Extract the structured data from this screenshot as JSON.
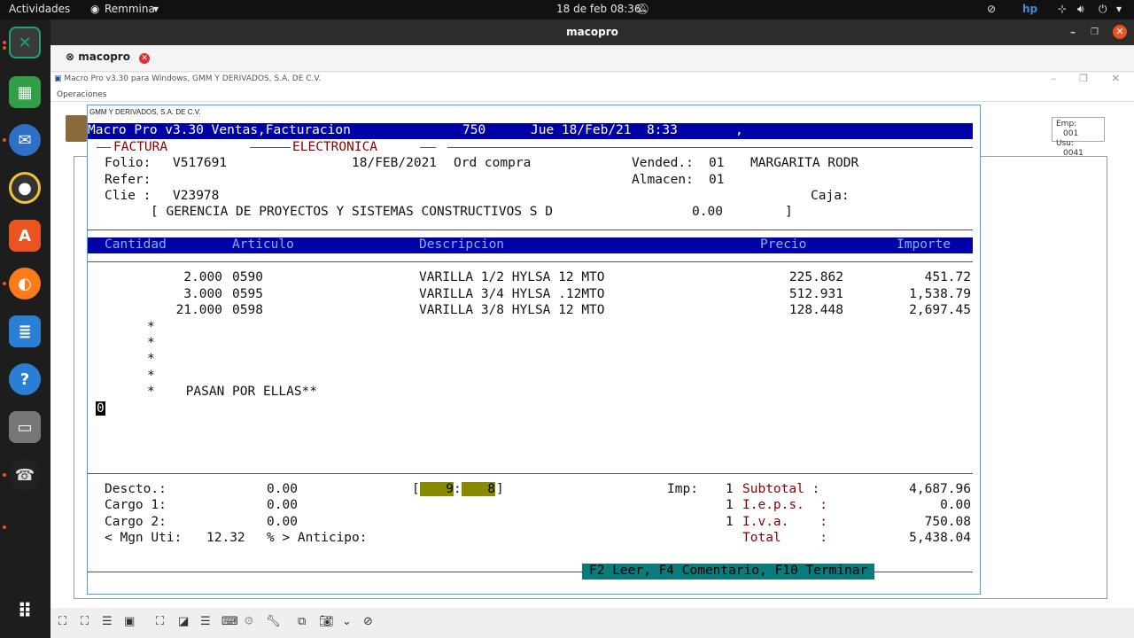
{
  "topbar": {
    "activities": "Actividades",
    "app_menu": "Remmina",
    "clock": "18 de feb  08:36"
  },
  "window": {
    "title": "macopro",
    "tab_label": "macopro"
  },
  "remote": {
    "title": "Macro Pro v3.30 para Windows, GMM Y DERIVADOS, S.A. DE C.V.",
    "menu": "Operaciones",
    "company": "GMM Y DERIVADOS, S.A. DE C.V.",
    "emp_label": "Emp:",
    "emp_value": "001",
    "usu_label": "Usu:",
    "usu_value": "0041"
  },
  "header": {
    "app": "Macro Pro v3.30 Ventas,Facturacion",
    "code": "750",
    "date": "Jue 18/Feb/21  8:33",
    "comma": ","
  },
  "doc": {
    "factura": "FACTURA",
    "electronica": "ELECTRONICA",
    "folio_label": "Folio:",
    "folio": "V517691",
    "fecha": "18/FEB/2021",
    "ord_compra": "Ord compra",
    "vended_label": "Vended.:",
    "vended": "01",
    "vendedor": "MARGARITA RODR",
    "refer_label": "Refer:",
    "almacen_label": "Almacen:",
    "almacen": "01",
    "clie_label": "Clie :",
    "clie": "V23978",
    "caja_label": "Caja:",
    "cliente_nombre": "[ GERENCIA DE PROYECTOS Y SISTEMAS CONSTRUCTIVOS S D",
    "saldo": "0.00",
    "close_bracket": "]"
  },
  "columns": {
    "cantidad": "Cantidad",
    "articulo": "Articulo",
    "descripcion": "Descripcion",
    "precio": "Precio",
    "importe": "Importe"
  },
  "rows": [
    {
      "cantidad": "2.000",
      "articulo": "0590",
      "descripcion": "VARILLA 1/2 HYLSA 12 MTO",
      "precio": "225.862",
      "importe": "451.72"
    },
    {
      "cantidad": "3.000",
      "articulo": "0595",
      "descripcion": "VARILLA 3/4 HYLSA .12MTO",
      "precio": "512.931",
      "importe": "1,538.79"
    },
    {
      "cantidad": "21.000",
      "articulo": "0598",
      "descripcion": "VARILLA 3/8 HYLSA 12 MTO",
      "precio": "128.448",
      "importe": "2,697.45"
    }
  ],
  "notes": [
    "*",
    "*",
    "*",
    "*",
    "*    PASAN POR ELLAS**"
  ],
  "cursor_input": "0",
  "totals": {
    "descto_label": "Descto.:",
    "descto": "0.00",
    "cargo1_label": "Cargo 1:",
    "cargo1": "0.00",
    "cargo2_label": "Cargo 2:",
    "cargo2": "0.00",
    "mgn_label": "< Mgn Uti:",
    "mgn": "12.32",
    "mgn_suffix": "% > Anticipo:",
    "time_open": "[",
    "time_h": "9",
    "time_sep": ":",
    "time_m": "8",
    "time_close": "]",
    "imp_label": "Imp:",
    "imp1": "1",
    "imp2": "1",
    "imp3": "1",
    "subtotal_label": "Subtotal :",
    "subtotal": "4,687.96",
    "ieps_label": "I.e.p.s.  :",
    "ieps": "0.00",
    "iva_label": "I.v.a.    :",
    "iva": "750.08",
    "total_label": "Total     :",
    "total": "5,438.04"
  },
  "footer_keys": "F2 Leer, F4 Comentario, F10 Terminar"
}
